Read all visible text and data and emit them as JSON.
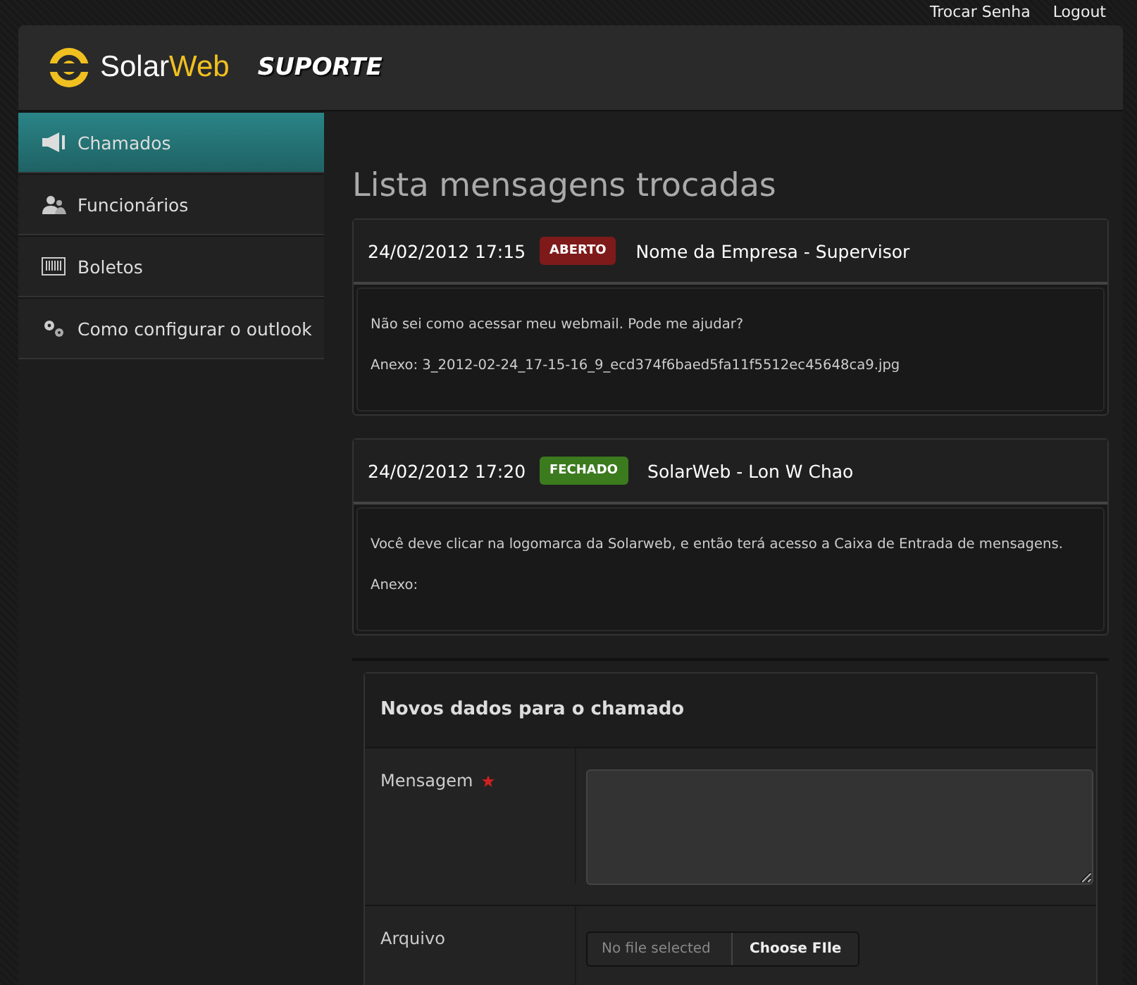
{
  "top_links": [
    "Trocar Senha",
    "Logout"
  ],
  "header": {
    "logo_part1": "Solar",
    "logo_part2": "Web",
    "title": "SUPORTE"
  },
  "sidebar": {
    "items": [
      {
        "label": "Chamados",
        "kind": "megaphone",
        "selected": true
      },
      {
        "label": "Funcionários",
        "kind": "people",
        "selected": false
      },
      {
        "label": "Boletos",
        "kind": "barcode",
        "selected": false
      },
      {
        "label": "Como configurar o outlook",
        "kind": "gears",
        "selected": false
      }
    ]
  },
  "page_title": "Lista mensagens trocadas",
  "messages": [
    {
      "datetime": "24/02/2012 17:15",
      "status": "ABERTO",
      "color": "#7e1a1a",
      "author": "Nome da Empresa - Supervisor",
      "text": "Não sei como acessar meu webmail. Pode me ajudar?",
      "attachment": "Anexo: 3_2012-02-24_17-15-16_9_ecd374f6baed5fa11f5512ec45648ca9.jpg"
    },
    {
      "datetime": "24/02/2012 17:20",
      "status": "FECHADO",
      "color": "#3c7a1e",
      "author": "SolarWeb - Lon W Chao",
      "text": "Você deve clicar na logomarca da Solarweb, e então terá acesso a Caixa de Entrada de mensagens.",
      "attachment": "Anexo:"
    }
  ],
  "form": {
    "title": "Novos dados para o chamado",
    "fields": [
      {
        "label": "Mensagem",
        "required": true,
        "kind": "textarea"
      },
      {
        "label": "Arquivo",
        "required": false,
        "kind": "file",
        "file_status": "No file selected",
        "button": "Choose FIle"
      }
    ]
  }
}
